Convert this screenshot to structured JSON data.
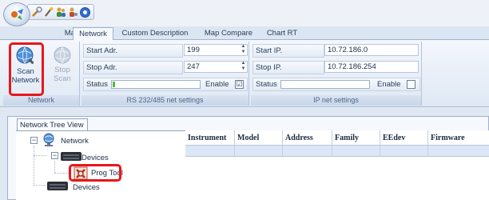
{
  "quick_access": {
    "icons": [
      "app-orb-icon",
      "tools-icon",
      "wand-icon",
      "users-icon",
      "user-link-icon",
      "help-icon"
    ]
  },
  "tabs": [
    {
      "label": "Map",
      "active": false
    },
    {
      "label": "Network",
      "active": true
    },
    {
      "label": "Custom Description",
      "active": false
    },
    {
      "label": "Map Compare",
      "active": false
    },
    {
      "label": "Chart RT",
      "active": false
    }
  ],
  "ribbon": {
    "network_group": {
      "label": "Network",
      "scan_button": {
        "line1": "Scan",
        "line2": "Network"
      },
      "stop_button": {
        "line1": "Stop",
        "line2": "Scan"
      }
    },
    "rs_group": {
      "label": "RS 232/485 net settings",
      "start_label": "Start Adr.",
      "start_value": "199",
      "stop_label": "Stop Adr.",
      "stop_value": "247",
      "status_label": "Status",
      "status_progress_percent": 3,
      "enable_label": "Enable",
      "enable_checked": true,
      "check_mark": "☑"
    },
    "ip_group": {
      "label": "IP net settings",
      "start_label": "Start IP.",
      "start_value": "10.72.186.0",
      "stop_label": "Stop IP.",
      "stop_value": "10.72.186.254",
      "status_label": "Status",
      "enable_label": "Enable",
      "enable_checked": false
    }
  },
  "panel": {
    "tab_label": "Network Tree View",
    "tree": {
      "root": "Network",
      "devices_1": "Devices",
      "prog_tool": "Prog Tool",
      "devices_2": "Devices",
      "collapse_symbol": "−"
    },
    "grid_columns": [
      "Instrument",
      "Model",
      "Address",
      "Family",
      "EEdev",
      "Firmware"
    ]
  },
  "colors": {
    "highlight": "#e8161c",
    "status_fill": "#58b83f"
  }
}
